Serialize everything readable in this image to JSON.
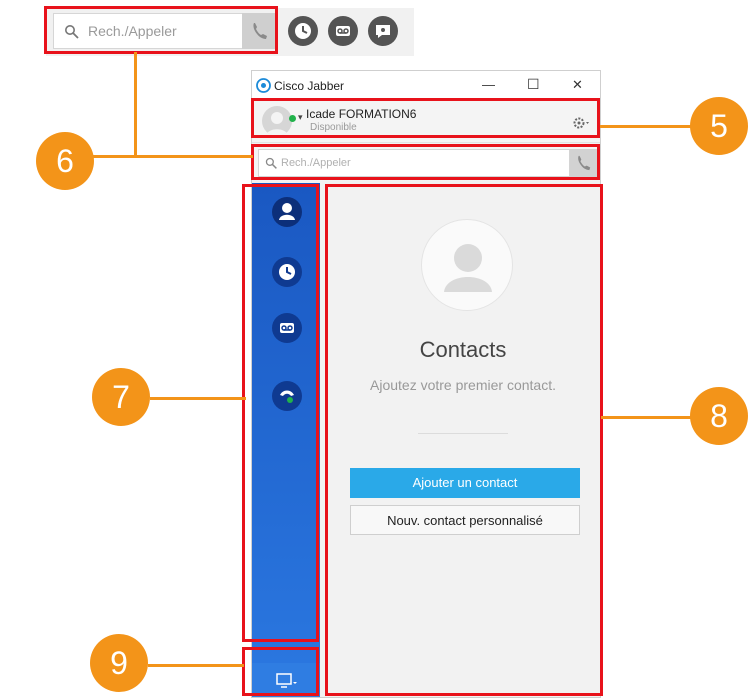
{
  "mini_toolbar": {
    "search_placeholder": "Rech./Appeler",
    "icons": [
      "search-icon",
      "phone-icon",
      "recent-calls-icon",
      "voicemail-icon",
      "chat-icon"
    ]
  },
  "window": {
    "title": "Cisco Jabber",
    "controls": {
      "minimize": "—",
      "maximize": "☐",
      "close": "✕"
    },
    "user": {
      "name": "Icade FORMATION6",
      "status": "Disponible",
      "status_color": "#21b24b"
    },
    "search_placeholder": "Rech./Appeler",
    "content": {
      "title": "Contacts",
      "subtitle": "Ajoutez votre premier contact.",
      "add_button": "Ajouter un contact",
      "custom_button": "Nouv. contact personnalisé"
    },
    "nav_items": [
      "contacts",
      "recents",
      "voicemail",
      "meetings"
    ]
  },
  "annotations": {
    "five": "5",
    "six": "6",
    "seven": "7",
    "eight": "8",
    "nine": "9"
  },
  "colors": {
    "accent_blue": "#1b63d0",
    "annotation_orange": "#f39419",
    "annotation_red": "#e8121b",
    "button_blue": "#2aa9e8"
  }
}
